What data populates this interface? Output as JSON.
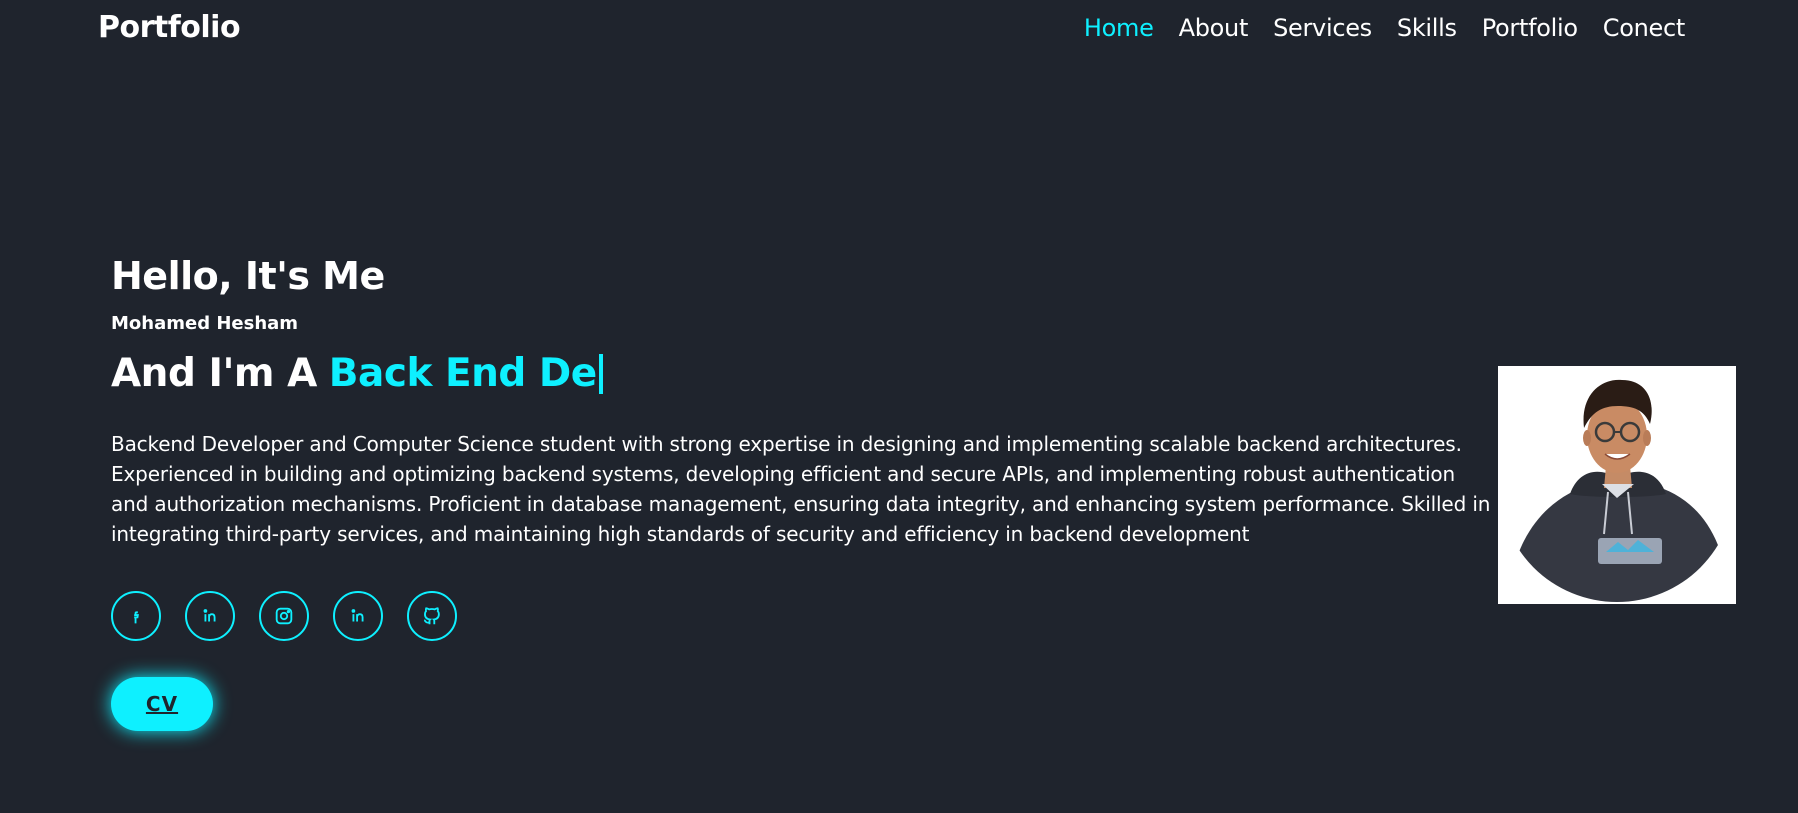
{
  "header": {
    "logo": "Portfolio",
    "nav": [
      {
        "label": "Home",
        "active": true
      },
      {
        "label": "About",
        "active": false
      },
      {
        "label": "Services",
        "active": false
      },
      {
        "label": "Skills",
        "active": false
      },
      {
        "label": "Portfolio",
        "active": false
      },
      {
        "label": "Conect",
        "active": false
      }
    ]
  },
  "hero": {
    "greeting": "Hello, It's Me",
    "name": "Mohamed Hesham",
    "role_prefix": "And I'm A",
    "role_typed": "Back End De",
    "description": "Backend Developer and Computer Science student with strong expertise in designing and implementing scalable backend architectures. Experienced in building and optimizing backend systems, developing efficient and secure APIs, and implementing robust authentication and authorization mechanisms. Proficient in database management, ensuring data integrity, and enhancing system performance. Skilled in integrating third-party services, and maintaining high standards of security and efficiency in backend development",
    "socials": [
      {
        "icon": "facebook-icon"
      },
      {
        "icon": "linkedin-icon"
      },
      {
        "icon": "instagram-icon"
      },
      {
        "icon": "linkedin-icon"
      },
      {
        "icon": "github-icon"
      }
    ],
    "cv_label": "CV"
  },
  "colors": {
    "background": "#1f242d",
    "accent": "#0ef0ff",
    "text": "#ffffff"
  }
}
